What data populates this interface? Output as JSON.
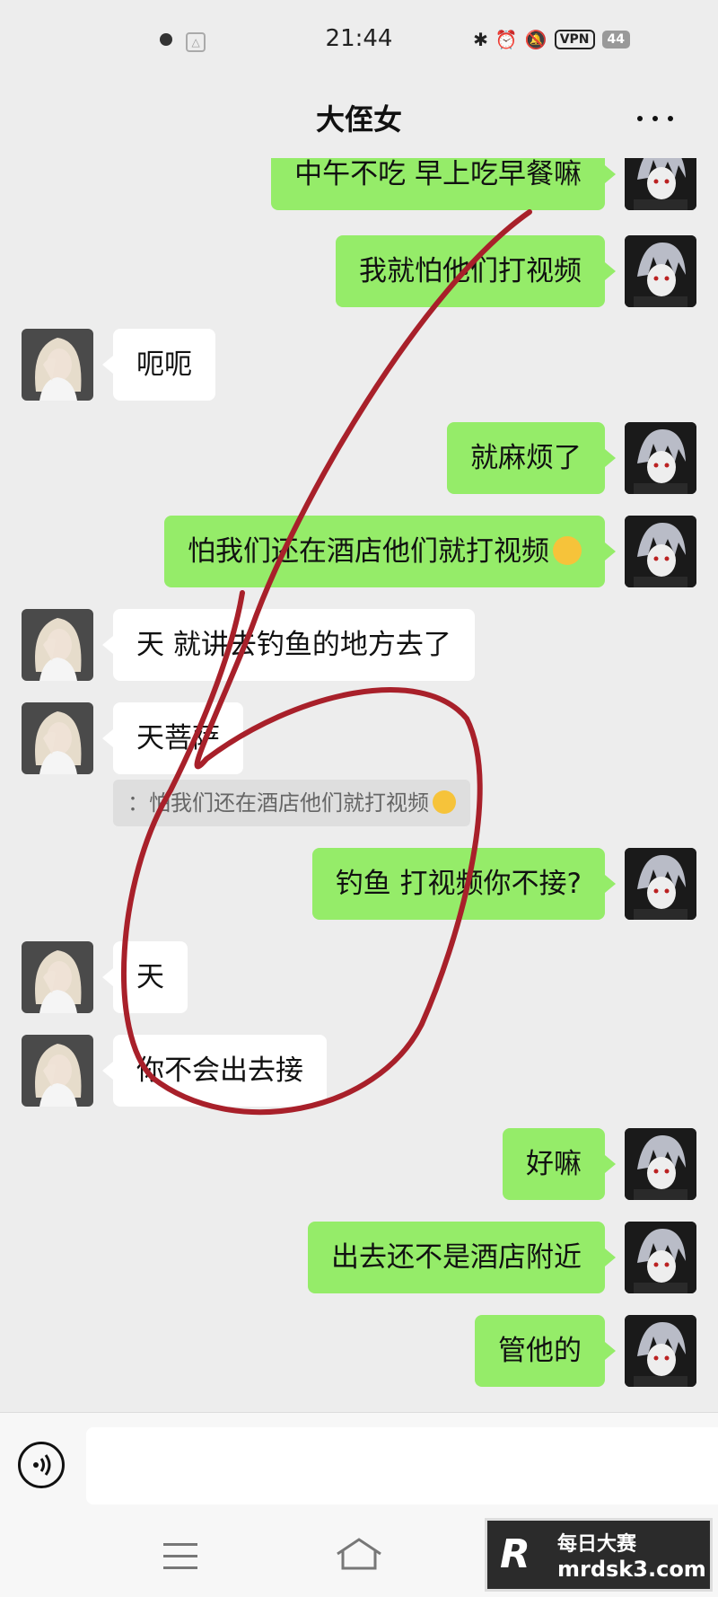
{
  "status_bar": {
    "time": "21:44",
    "icons": [
      "bluetooth-icon",
      "alarm-icon",
      "mute-icon"
    ],
    "vpn": "VPN",
    "battery": "44"
  },
  "header": {
    "title": "大侄女",
    "more_icon": "more-dots-icon"
  },
  "messages": [
    {
      "side": "me",
      "text": "中午不吃 早上吃早餐嘛"
    },
    {
      "side": "me",
      "text": "我就怕他们打视频"
    },
    {
      "side": "other",
      "text": "呃呃"
    },
    {
      "side": "me",
      "text": "就麻烦了"
    },
    {
      "side": "me",
      "text": "怕我们还在酒店他们就打视频",
      "emoji": "tears-of-joy-emoji"
    },
    {
      "side": "other",
      "text": "天   就讲去钓鱼的地方去了"
    },
    {
      "side": "other",
      "text": "天菩萨"
    },
    {
      "side": "quote",
      "text": "：怕我们还在酒店他们就打视频",
      "emoji": "tears-of-joy-emoji"
    },
    {
      "side": "me",
      "text": "钓鱼 打视频你不接?"
    },
    {
      "side": "other",
      "text": "天"
    },
    {
      "side": "other",
      "text": "你不会出去接"
    },
    {
      "side": "me",
      "text": "好嘛"
    },
    {
      "side": "me",
      "text": "出去还不是酒店附近"
    },
    {
      "side": "me",
      "text": "管他的"
    }
  ],
  "input_bar": {
    "voice_icon": "voice-icon",
    "placeholder": ""
  },
  "nav_bar": {
    "icons": [
      "menu-icon",
      "home-icon",
      "back-icon"
    ]
  },
  "watermark": {
    "line1": "每日大赛",
    "line2": "mrdsk3.com"
  },
  "colors": {
    "background": "#ededed",
    "my_bubble": "#95ec69",
    "their_bubble": "#ffffff",
    "scribble": "#a8202a"
  }
}
